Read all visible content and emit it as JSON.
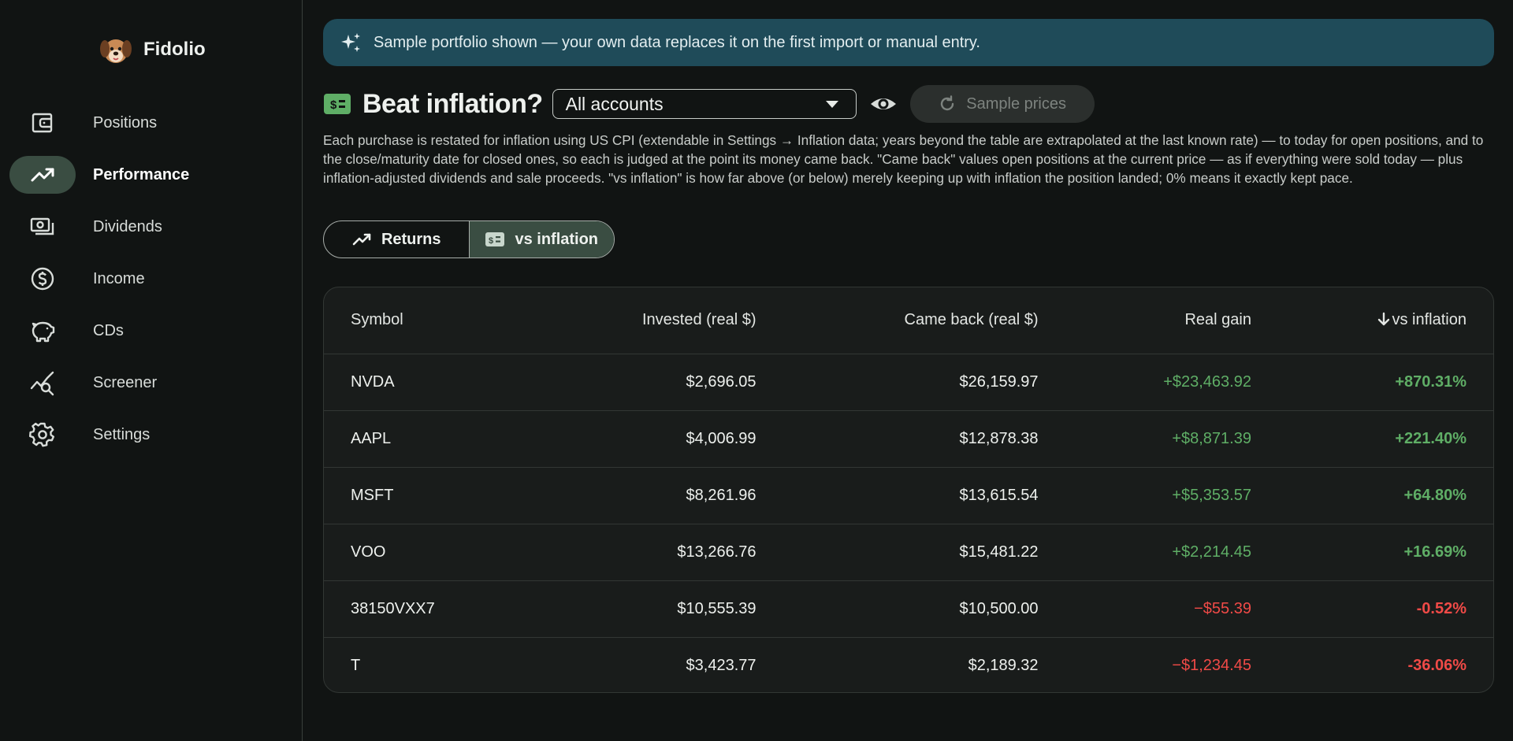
{
  "app": {
    "name": "Fidolio"
  },
  "sidebar": {
    "items": [
      {
        "label": "Positions",
        "icon": "wallet-icon",
        "active": false
      },
      {
        "label": "Performance",
        "icon": "trending-up-icon",
        "active": true
      },
      {
        "label": "Dividends",
        "icon": "cash-stack-icon",
        "active": false
      },
      {
        "label": "Income",
        "icon": "dollar-circle-icon",
        "active": false
      },
      {
        "label": "CDs",
        "icon": "piggy-bank-icon",
        "active": false
      },
      {
        "label": "Screener",
        "icon": "chart-search-icon",
        "active": false
      },
      {
        "label": "Settings",
        "icon": "gear-icon",
        "active": false
      }
    ]
  },
  "banner": {
    "text": "Sample portfolio shown — your own data replaces it on the first import or manual entry.",
    "icon": "sparkle-icon"
  },
  "header": {
    "title": "Beat inflation?",
    "account_select": {
      "value": "All accounts"
    },
    "sample_prices_label": "Sample prices"
  },
  "description": "Each purchase is restated for inflation using US CPI (extendable in Settings → Inflation data; years beyond the table are extrapolated at the last known rate) — to today for open positions, and to the close/maturity date for closed ones, so each is judged at the point its money came back. \"Came back\" values open positions at the current price — as if everything were sold today — plus inflation-adjusted dividends and sale proceeds. \"vs inflation\" is how far above (or below) merely keeping up with inflation the position landed; 0% means it exactly kept pace.",
  "view_toggle": {
    "returns_label": "Returns",
    "inflation_label": "vs inflation",
    "active": "inflation"
  },
  "table": {
    "columns": {
      "symbol": "Symbol",
      "invested": "Invested (real $)",
      "came_back": "Came back (real $)",
      "real_gain": "Real gain",
      "vs_inflation": "vs inflation"
    },
    "rows": [
      {
        "symbol": "NVDA",
        "invested": "$2,696.05",
        "came_back": "$26,159.97",
        "real_gain": "+$23,463.92",
        "vs_inflation": "+870.31%",
        "positive": true
      },
      {
        "symbol": "AAPL",
        "invested": "$4,006.99",
        "came_back": "$12,878.38",
        "real_gain": "+$8,871.39",
        "vs_inflation": "+221.40%",
        "positive": true
      },
      {
        "symbol": "MSFT",
        "invested": "$8,261.96",
        "came_back": "$13,615.54",
        "real_gain": "+$5,353.57",
        "vs_inflation": "+64.80%",
        "positive": true
      },
      {
        "symbol": "VOO",
        "invested": "$13,266.76",
        "came_back": "$15,481.22",
        "real_gain": "+$2,214.45",
        "vs_inflation": "+16.69%",
        "positive": true
      },
      {
        "symbol": "38150VXX7",
        "invested": "$10,555.39",
        "came_back": "$10,500.00",
        "real_gain": "−$55.39",
        "vs_inflation": "-0.52%",
        "positive": false
      },
      {
        "symbol": "T",
        "invested": "$3,423.77",
        "came_back": "$2,189.32",
        "real_gain": "−$1,234.45",
        "vs_inflation": "-36.06%",
        "positive": false
      }
    ]
  },
  "colors": {
    "accent": "#3a4d42",
    "banner": "#1f4b59",
    "positive": "#5fae66",
    "negative": "#f04a47"
  }
}
